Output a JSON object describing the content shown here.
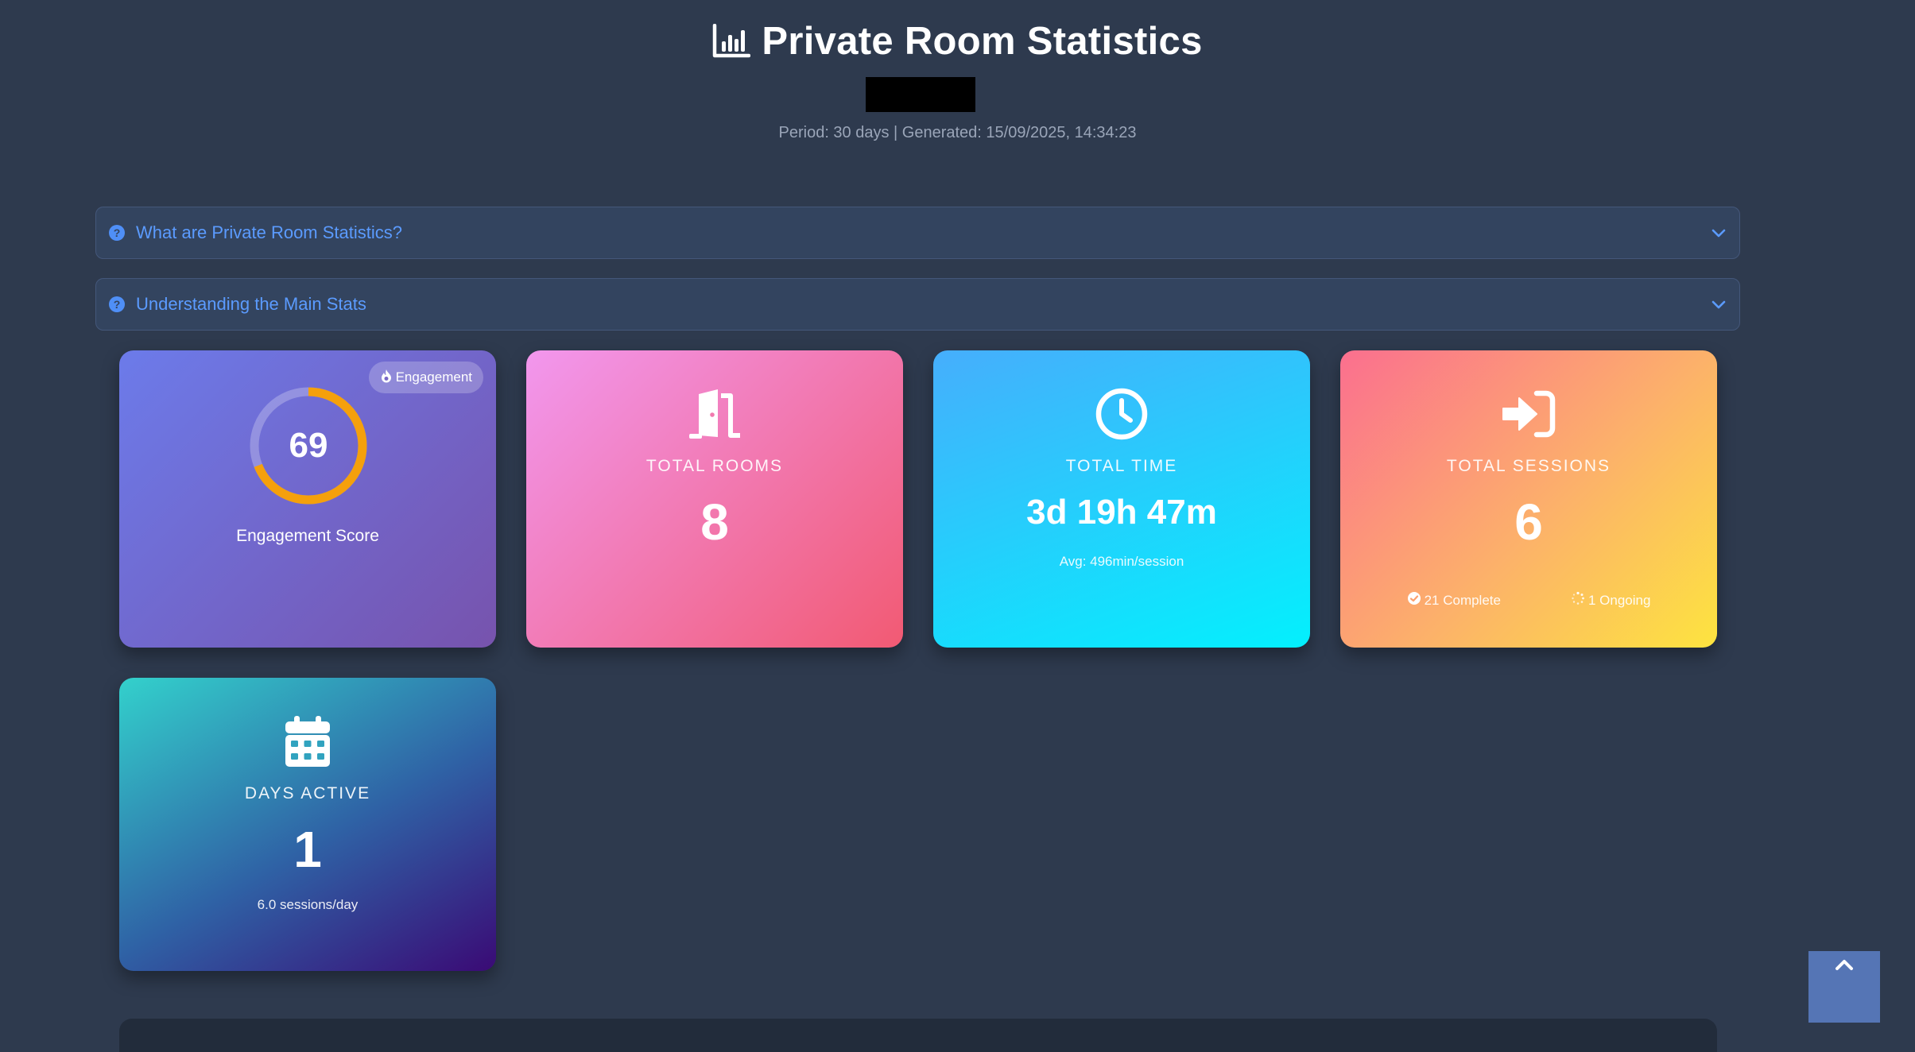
{
  "header": {
    "title": "Private Room Statistics",
    "title_icon": "bar-chart-icon",
    "meta": "Period: 30 days | Generated: 15/09/2025, 14:34:23"
  },
  "accordions": [
    {
      "label": "What are Private Room Statistics?",
      "icon": "question-circle-icon",
      "chevron": "chevron-down-icon"
    },
    {
      "label": "Understanding the Main Stats",
      "icon": "question-circle-icon",
      "chevron": "chevron-down-icon"
    }
  ],
  "cards": {
    "engagement": {
      "badge": "Engagement",
      "badge_icon": "fire-icon",
      "score": "69",
      "score_fraction": 0.69,
      "label": "Engagement Score",
      "ring_color": "#f5a00c"
    },
    "rooms": {
      "icon": "door-open-icon",
      "label": "TOTAL ROOMS",
      "value": "8"
    },
    "time": {
      "icon": "clock-icon",
      "label": "TOTAL TIME",
      "value": "3d 19h 47m",
      "sub": "Avg: 496min/session"
    },
    "sessions": {
      "icon": "sign-in-icon",
      "label": "TOTAL SESSIONS",
      "value": "6",
      "complete": "21 Complete",
      "ongoing": "1 Ongoing"
    },
    "days": {
      "icon": "calendar-icon",
      "label": "DAYS ACTIVE",
      "value": "1",
      "sub": "6.0 sessions/day"
    }
  },
  "scroll_top": {
    "icon": "chevron-up-icon"
  },
  "colors": {
    "background": "#2e3a4e",
    "accent": "#5b9bff"
  }
}
